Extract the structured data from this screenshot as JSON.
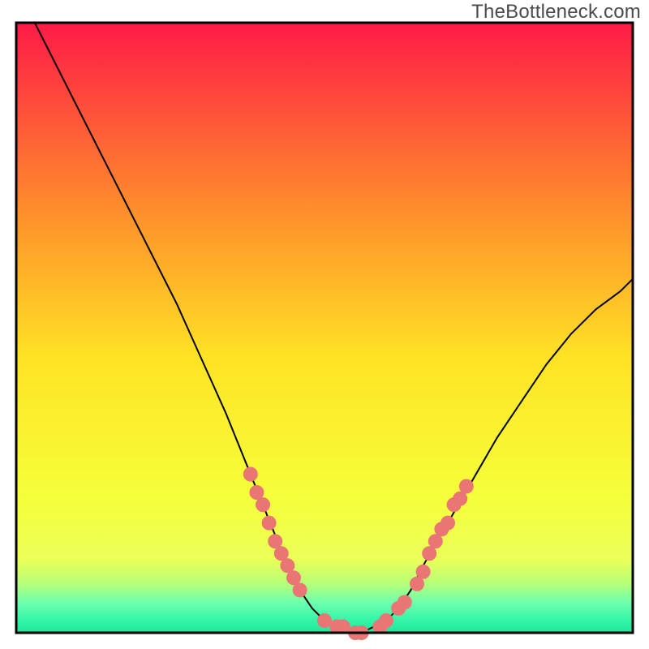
{
  "watermark": "TheBottleneck.com",
  "colors": {
    "border": "#000000",
    "curve": "#000000",
    "dot_fill": "#e97575",
    "dot_stroke": "#e97575",
    "grad_top": "#ff1a47",
    "grad_upper_mid": "#ff8b2c",
    "grad_mid": "#ffe324",
    "grad_lower": "#f5ff3a",
    "grad_bottom_yellow": "#eaff58",
    "grad_green1": "#b6ff7a",
    "grad_green2": "#6dffad",
    "grad_green3": "#33f5a7",
    "grad_green4": "#1ee79b"
  },
  "chart_data": {
    "type": "line",
    "title": "",
    "xlabel": "",
    "ylabel": "",
    "xlim": [
      0,
      100
    ],
    "ylim": [
      0,
      100
    ],
    "x": [
      3,
      6,
      10,
      14,
      18,
      22,
      26,
      30,
      34,
      36,
      38,
      40,
      42,
      44,
      46,
      48,
      50,
      52,
      54,
      56,
      58,
      60,
      62,
      64,
      66,
      70,
      74,
      78,
      82,
      86,
      90,
      94,
      98,
      100
    ],
    "y": [
      100,
      94,
      86,
      78,
      70,
      62,
      54,
      45,
      36,
      31,
      26,
      21,
      16,
      11,
      7,
      4,
      2,
      1,
      0,
      0,
      1,
      2,
      4,
      7,
      11,
      18,
      25,
      32,
      38,
      44,
      49,
      53,
      56,
      58
    ],
    "annotations_note": "Salmon dots appear on the curve in the lower region (approx y<=25) on both descending and ascending arms, clustered near the valley.",
    "dot_points": [
      {
        "x": 38,
        "y": 26
      },
      {
        "x": 39,
        "y": 23
      },
      {
        "x": 40,
        "y": 21
      },
      {
        "x": 41,
        "y": 18
      },
      {
        "x": 42,
        "y": 15
      },
      {
        "x": 43,
        "y": 13
      },
      {
        "x": 44,
        "y": 11
      },
      {
        "x": 45,
        "y": 9
      },
      {
        "x": 46,
        "y": 7
      },
      {
        "x": 50,
        "y": 2
      },
      {
        "x": 52,
        "y": 1
      },
      {
        "x": 53,
        "y": 1
      },
      {
        "x": 55,
        "y": 0
      },
      {
        "x": 56,
        "y": 0
      },
      {
        "x": 59,
        "y": 1
      },
      {
        "x": 60,
        "y": 2
      },
      {
        "x": 62,
        "y": 4
      },
      {
        "x": 63,
        "y": 5
      },
      {
        "x": 65,
        "y": 8
      },
      {
        "x": 66,
        "y": 10
      },
      {
        "x": 67,
        "y": 13
      },
      {
        "x": 68,
        "y": 15
      },
      {
        "x": 69,
        "y": 17
      },
      {
        "x": 70,
        "y": 18
      },
      {
        "x": 71,
        "y": 21
      },
      {
        "x": 72,
        "y": 22
      },
      {
        "x": 73,
        "y": 24
      }
    ]
  }
}
